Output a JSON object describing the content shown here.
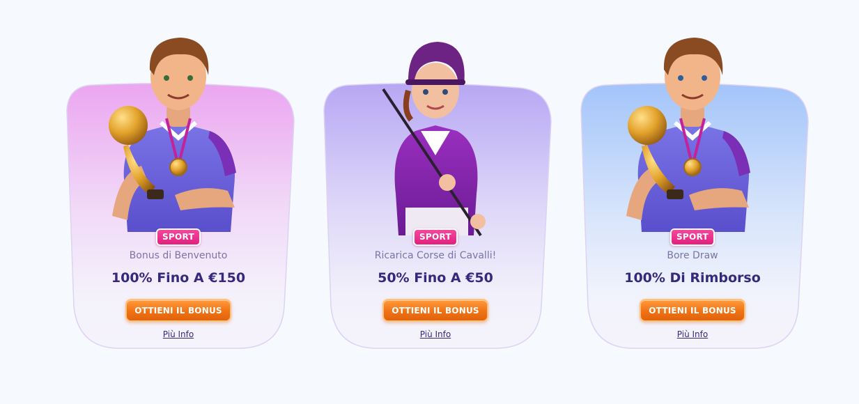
{
  "promos": [
    {
      "badge": "SPORT",
      "subtitle": "Bonus di Benvenuto",
      "headline": "100% Fino A €150",
      "cta": "OTTIENI IL BONUS",
      "more": "Più Info",
      "theme": "pink",
      "illustration": "footballer-with-trophy"
    },
    {
      "badge": "SPORT",
      "subtitle": "Ricarica Corse di Cavalli!",
      "headline": "50% Fino A €50",
      "cta": "OTTIENI IL BONUS",
      "more": "Più Info",
      "theme": "purple",
      "illustration": "jockey-with-riding-crop"
    },
    {
      "badge": "SPORT",
      "subtitle": "Bore Draw",
      "headline": "100% Di Rimborso",
      "cta": "OTTIENI IL BONUS",
      "more": "Più Info",
      "theme": "blue",
      "illustration": "footballer-with-trophy"
    }
  ],
  "colors": {
    "page_background": "#f6f9fe",
    "badge": "#e8288a",
    "headline": "#35297d",
    "subtitle": "#7a73a8",
    "cta": "#f07315",
    "pink_glow": "#eba6f0",
    "purple_glow": "#b7a7f4",
    "blue_glow": "#a3c4fa"
  }
}
